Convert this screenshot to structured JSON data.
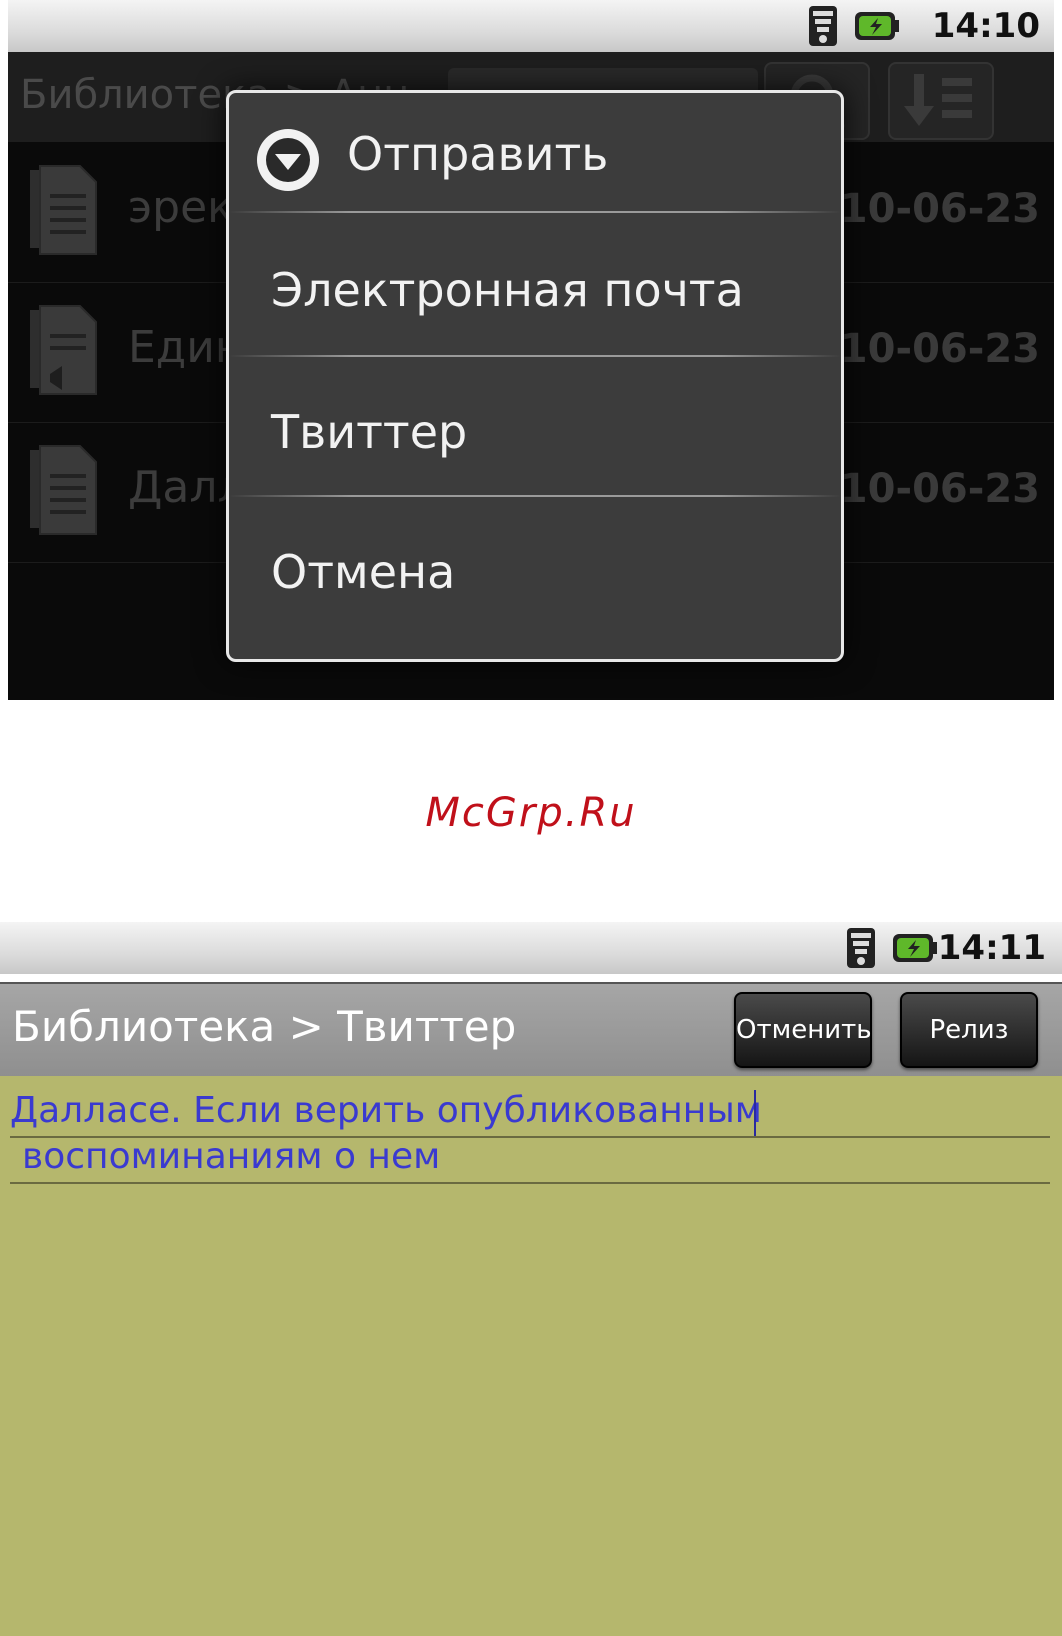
{
  "screen1": {
    "status": {
      "time": "14:10"
    },
    "title": "Библиотека > Анн...",
    "rows": [
      {
        "name": "эрекция",
        "date": "2010-06-23"
      },
      {
        "name": "Единственн...",
        "date": "2010-06-23"
      },
      {
        "name": "Далласе. Е...",
        "date": "2010-06-23"
      }
    ],
    "dialog": {
      "title": "Отправить",
      "options": [
        "Электронная почта",
        "Твиттер",
        "Отмена"
      ]
    }
  },
  "watermark": "McGrp.Ru",
  "screen2": {
    "status": {
      "time": "14:11"
    },
    "title": "Библиотека > Твиттер",
    "buttons": {
      "cancel": "Отменить",
      "release": "Релиз"
    },
    "text_lines": [
      "Далласе. Если верить опубликованным",
      "воспоминаниям о нем"
    ]
  },
  "colors": {
    "editor_background": "#b5b76d",
    "editor_text": "#3a3ad0",
    "watermark": "#c0101a",
    "dialog_background": "#3c3c3c"
  }
}
